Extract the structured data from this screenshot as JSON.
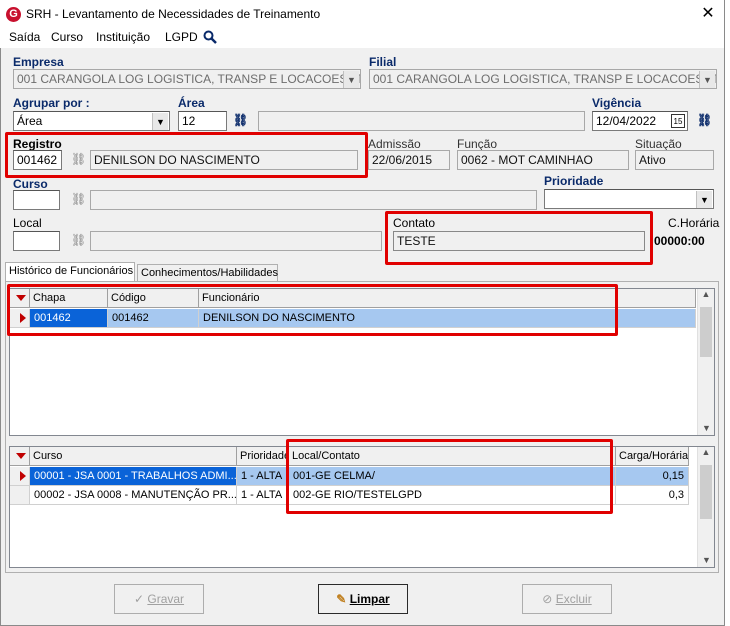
{
  "window": {
    "title": "SRH - Levantamento de Necessidades de Treinamento",
    "close": "✕",
    "logo": "G"
  },
  "menu": [
    "Saída",
    "Curso",
    "Instituição",
    "LGPD"
  ],
  "empresa": {
    "label": "Empresa",
    "value": "001 CARANGOLA LOG LOGISTICA, TRANSP E LOCACOES LTDA"
  },
  "filial": {
    "label": "Filial",
    "value": "001 CARANGOLA LOG LOGISTICA, TRANSP E LOCACOES LTDA"
  },
  "agrupar": {
    "label": "Agrupar por :",
    "value": "Área"
  },
  "area": {
    "label": "Área",
    "value": "12",
    "desc": ""
  },
  "vigencia": {
    "label": "Vigência",
    "value": "12/04/2022",
    "cal": "15"
  },
  "registro": {
    "label": "Registro",
    "value": "001462",
    "nome": "DENILSON DO NASCIMENTO"
  },
  "admissao": {
    "label": "Admissão",
    "value": "22/06/2015"
  },
  "funcao": {
    "label": "Função",
    "value": "0062 - MOT CAMINHAO"
  },
  "situacao": {
    "label": "Situação",
    "value": "Ativo"
  },
  "curso": {
    "label": "Curso",
    "value": ""
  },
  "prioridade": {
    "label": "Prioridade",
    "value": ""
  },
  "local": {
    "label": "Local",
    "value": ""
  },
  "contato": {
    "label": "Contato",
    "value": "TESTE"
  },
  "choraria": {
    "label": "C.Horária",
    "value": "00000:00"
  },
  "tabs": [
    "Histórico de Funcionários",
    "Conhecimentos/Habilidades"
  ],
  "funcionarios": {
    "headers": [
      "Chapa",
      "Código",
      "Funcionário"
    ],
    "rows": [
      {
        "chapa": "001462",
        "codigo": "001462",
        "funcionario": "DENILSON DO NASCIMENTO"
      }
    ]
  },
  "cursos": {
    "headers": [
      "Curso",
      "Prioridade",
      "Local/Contato",
      "Carga/Horária"
    ],
    "rows": [
      {
        "curso": "00001 - JSA 0001 - TRABALHOS ADMI...",
        "prioridade": "1 - ALTA",
        "local": "001-GE CELMA/",
        "carga": "0,15"
      },
      {
        "curso": "00002 - JSA 0008 - MANUTENÇÃO PR...",
        "prioridade": "1 - ALTA",
        "local": "002-GE RIO/TESTELGPD",
        "carga": "0,3"
      }
    ]
  },
  "buttons": {
    "gravar": "Gravar",
    "limpar": "Limpar",
    "excluir": "Excluir"
  },
  "icons": {
    "search": "search-icon",
    "binoculars": "binoculars-icon",
    "calendar": "calendar-icon",
    "check": "check-icon",
    "eraser": "eraser-icon",
    "delete": "delete-icon"
  }
}
